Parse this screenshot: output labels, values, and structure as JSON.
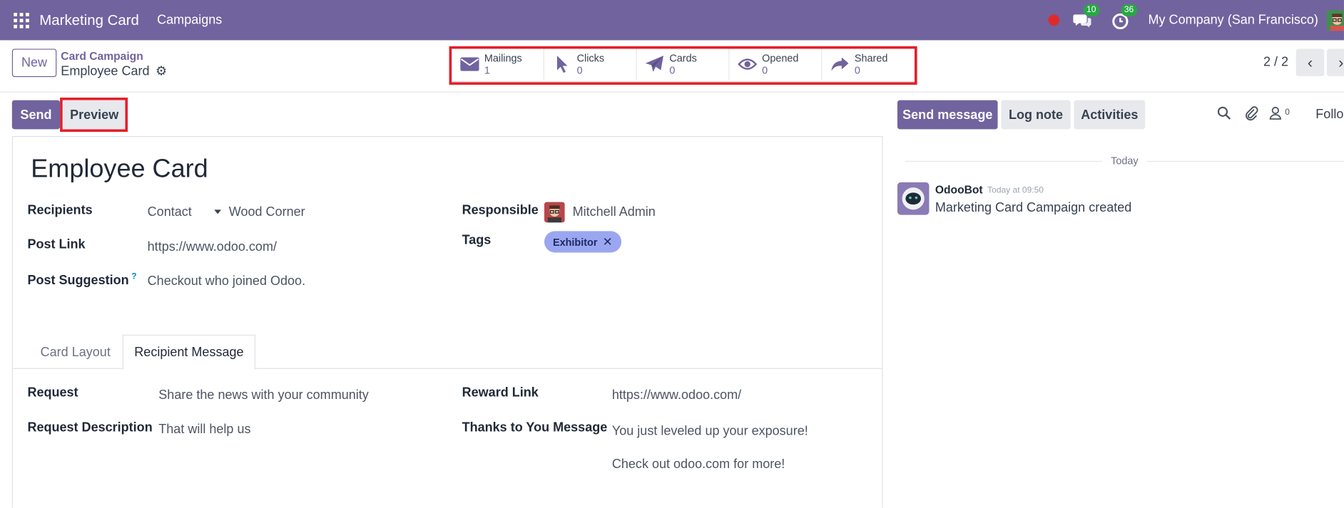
{
  "navbar": {
    "brand": "Marketing Card",
    "menu_item": "Campaigns",
    "messages_badge": "10",
    "activities_badge": "36",
    "company": "My Company (San Francisco)"
  },
  "control_panel": {
    "new_label": "New",
    "breadcrumb_parent": "Card Campaign",
    "breadcrumb_current": "Employee Card",
    "pager": "2 / 2",
    "stats": [
      {
        "label": "Mailings",
        "value": "1",
        "icon": "envelope-icon"
      },
      {
        "label": "Clicks",
        "value": "0",
        "icon": "cursor-icon"
      },
      {
        "label": "Cards",
        "value": "0",
        "icon": "paper-plane-icon"
      },
      {
        "label": "Opened",
        "value": "0",
        "icon": "eye-icon"
      },
      {
        "label": "Shared",
        "value": "0",
        "icon": "share-icon"
      }
    ]
  },
  "actions": {
    "send_label": "Send",
    "preview_label": "Preview"
  },
  "form": {
    "title": "Employee Card",
    "recipients_label": "Recipients",
    "recipients_model": "Contact",
    "recipients_value": "Wood Corner",
    "post_link_label": "Post Link",
    "post_link_value": "https://www.odoo.com/",
    "post_suggestion_label": "Post Suggestion",
    "post_suggestion_help": "?",
    "post_suggestion_value": "Checkout who joined Odoo.",
    "responsible_label": "Responsible",
    "responsible_value": "Mitchell Admin",
    "tags_label": "Tags",
    "tag_value": "Exhibitor",
    "tabs": [
      "Card Layout",
      "Recipient Message"
    ],
    "request_label": "Request",
    "request_value": "Share the news with your community",
    "request_desc_label": "Request Description",
    "request_desc_value": "That will help us",
    "reward_link_label": "Reward Link",
    "reward_link_value": "https://www.odoo.com/",
    "thanks_label": "Thanks to You Message",
    "thanks_line1": "You just leveled up your exposure!",
    "thanks_line2": "Check out odoo.com for more!"
  },
  "chatter": {
    "send_message_label": "Send message",
    "log_note_label": "Log note",
    "activities_label": "Activities",
    "followers_count": "0",
    "follow_label": "Follo",
    "date_separator": "Today",
    "author": "OdooBot",
    "time": "Today at 09:50",
    "message": "Marketing Card Campaign created"
  },
  "colors": {
    "brand": "#71639e",
    "highlight_border": "#e41e2a",
    "tag": "#9aa7f0",
    "badge": "#28a745"
  }
}
